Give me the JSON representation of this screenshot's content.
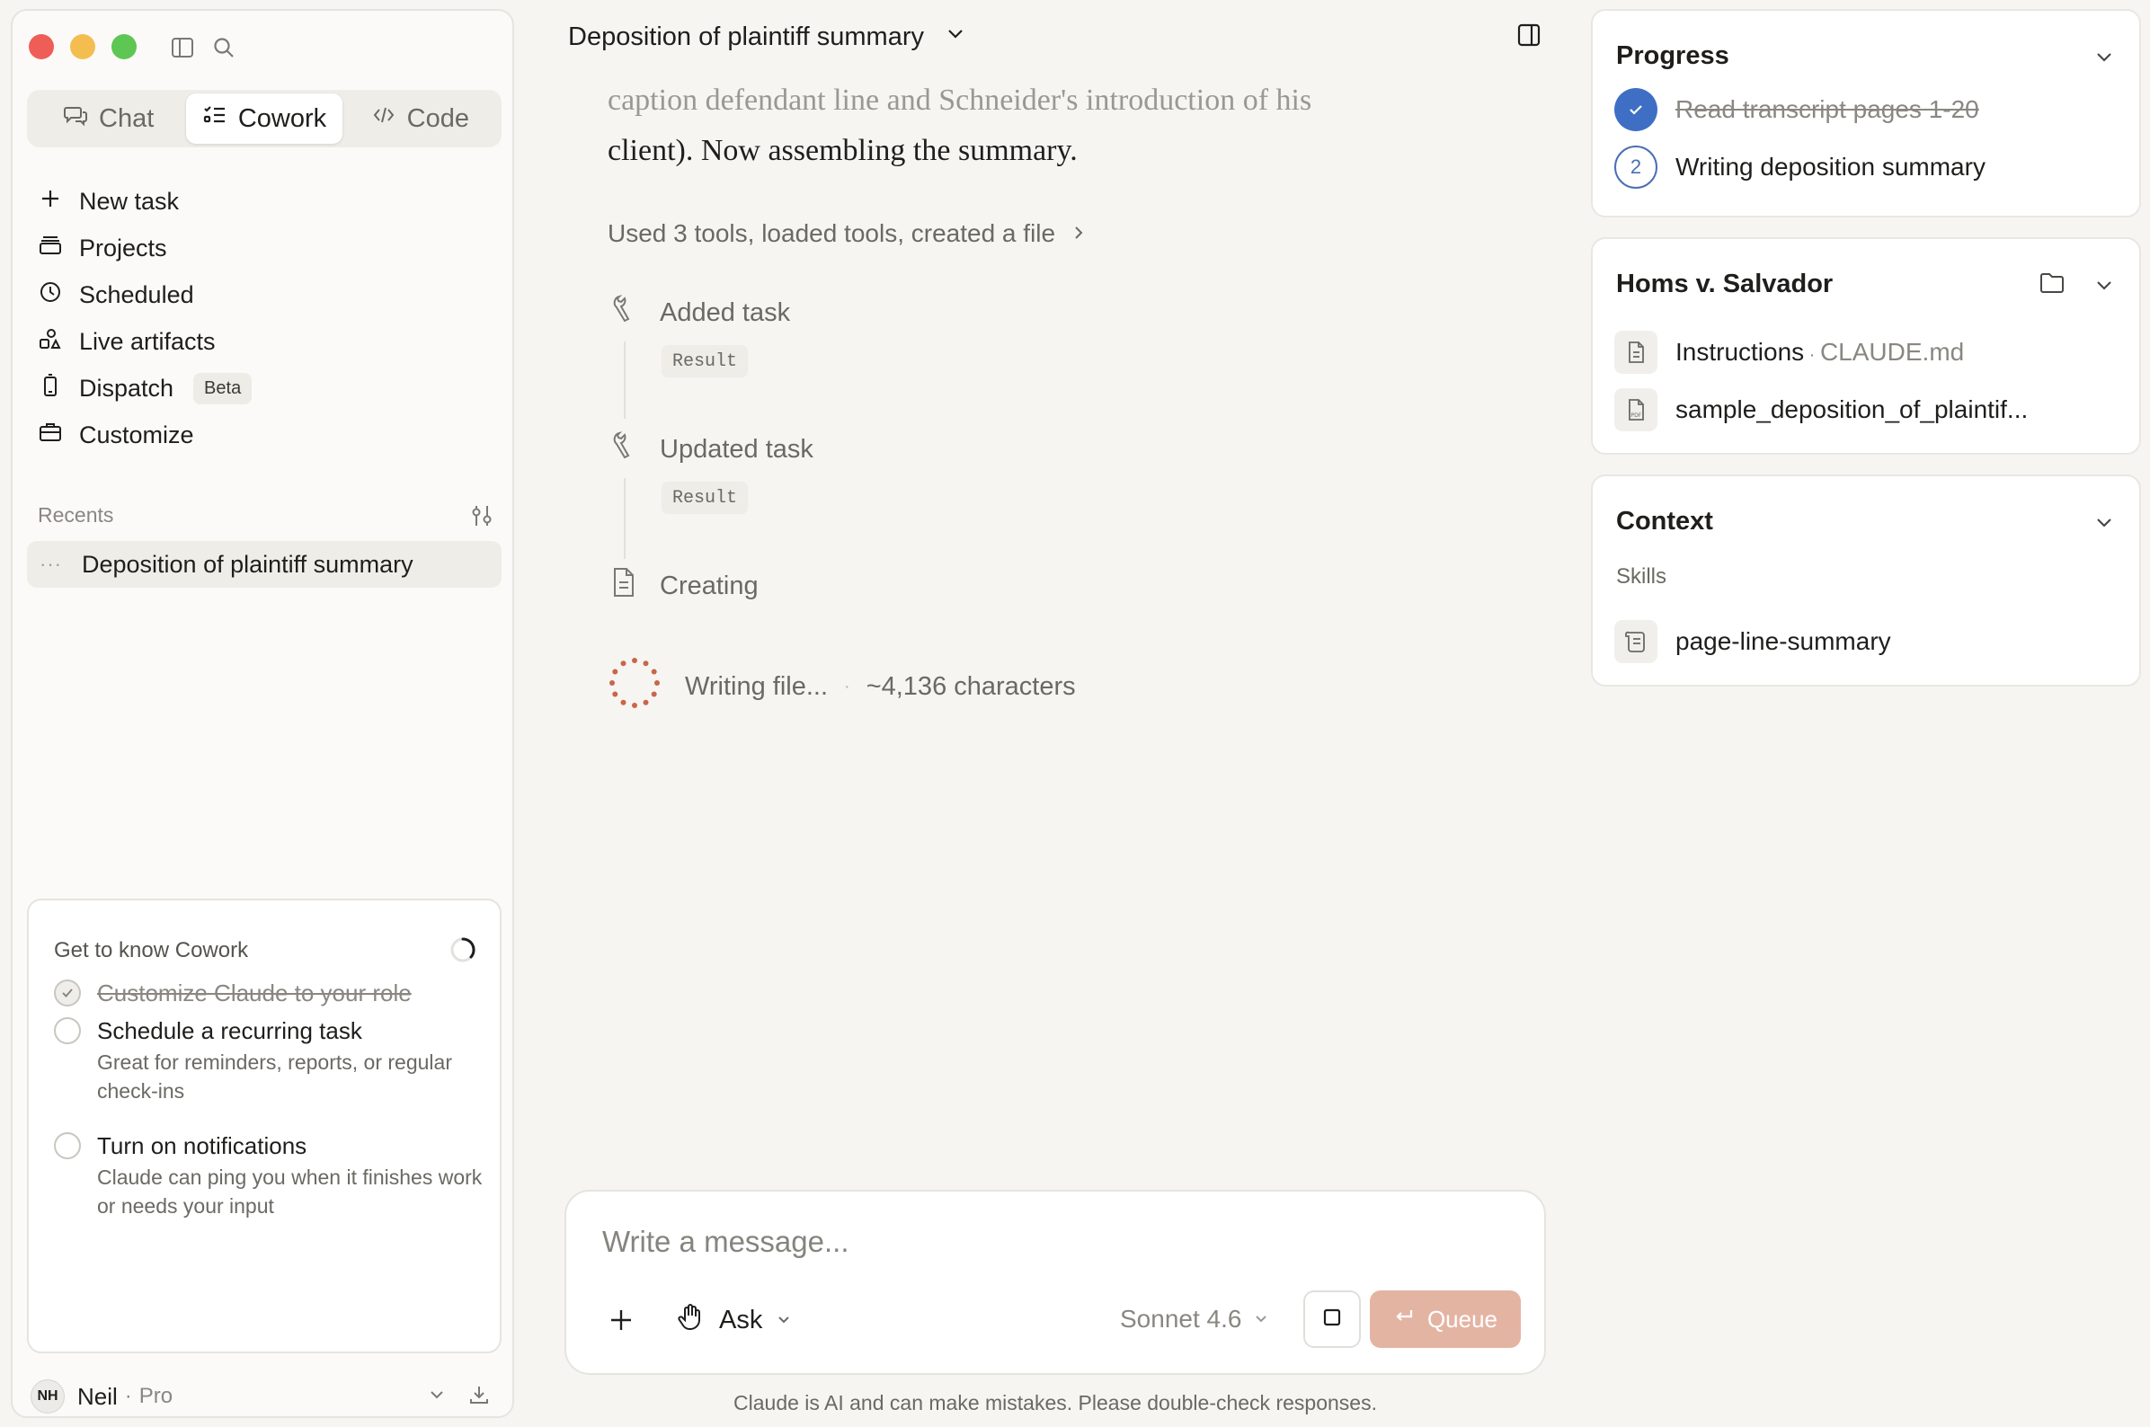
{
  "sidebar": {
    "mode_tabs": [
      {
        "label": "Chat",
        "icon": "chat-bubbles-icon"
      },
      {
        "label": "Cowork",
        "icon": "checklist-icon",
        "active": true
      },
      {
        "label": "Code",
        "icon": "code-brackets-icon"
      }
    ],
    "nav": [
      {
        "label": "New task",
        "icon": "plus-icon"
      },
      {
        "label": "Projects",
        "icon": "folder-stack-icon"
      },
      {
        "label": "Scheduled",
        "icon": "clock-icon"
      },
      {
        "label": "Live artifacts",
        "icon": "shapes-icon"
      },
      {
        "label": "Dispatch",
        "icon": "phone-icon",
        "badge": "Beta"
      },
      {
        "label": "Customize",
        "icon": "briefcase-icon"
      }
    ],
    "recents_label": "Recents",
    "recents": [
      {
        "label": "Deposition of plaintiff summary",
        "prefix": "···"
      }
    ],
    "get_to_know": {
      "title": "Get to know Cowork",
      "items": [
        {
          "title": "Customize Claude to your role",
          "done": true
        },
        {
          "title": "Schedule a recurring task",
          "subtitle": "Great for reminders, reports, or regular check-ins",
          "done": false
        },
        {
          "title": "Turn on notifications",
          "subtitle": "Claude can ping you when it finishes work or needs your input",
          "done": false
        }
      ]
    },
    "user": {
      "initials": "NH",
      "name": "Neil",
      "plan": "Pro"
    }
  },
  "main": {
    "title": "Deposition of plaintiff summary",
    "message": {
      "line1": "caption defendant line and Schneider's introduction of his",
      "line2": "client). Now assembling the summary."
    },
    "tools_summary": "Used 3 tools, loaded tools, created a file",
    "steps": [
      {
        "label": "Added task",
        "result": "Result",
        "icon": "wrench-icon"
      },
      {
        "label": "Updated task",
        "result": "Result",
        "icon": "wrench-icon"
      },
      {
        "label": "Creating",
        "icon": "document-icon"
      }
    ],
    "writing": {
      "label": "Writing file...",
      "detail": "~4,136 characters"
    },
    "composer": {
      "placeholder": "Write a message...",
      "mode": "Ask",
      "model": "Sonnet 4.6",
      "queue_label": "Queue"
    },
    "disclaimer": "Claude is AI and can make mistakes. Please double-check responses."
  },
  "right": {
    "progress": {
      "title": "Progress",
      "items": [
        {
          "label": "Read transcript pages 1-20",
          "done": true
        },
        {
          "label": "Writing deposition summary",
          "number": "2",
          "done": false
        }
      ]
    },
    "project": {
      "title": "Homs v. Salvador",
      "files": [
        {
          "name": "Instructions",
          "detail": "CLAUDE.md",
          "icon": "document-icon"
        },
        {
          "name": "sample_deposition_of_plaintif...",
          "icon": "pdf-icon"
        }
      ]
    },
    "context": {
      "title": "Context",
      "skills_label": "Skills",
      "skills": [
        {
          "name": "page-line-summary",
          "icon": "scroll-icon"
        }
      ]
    }
  },
  "colors": {
    "accent_blue": "#3e6fc4",
    "queue_button": "#e4b4a3",
    "spinner": "#c8664a"
  }
}
